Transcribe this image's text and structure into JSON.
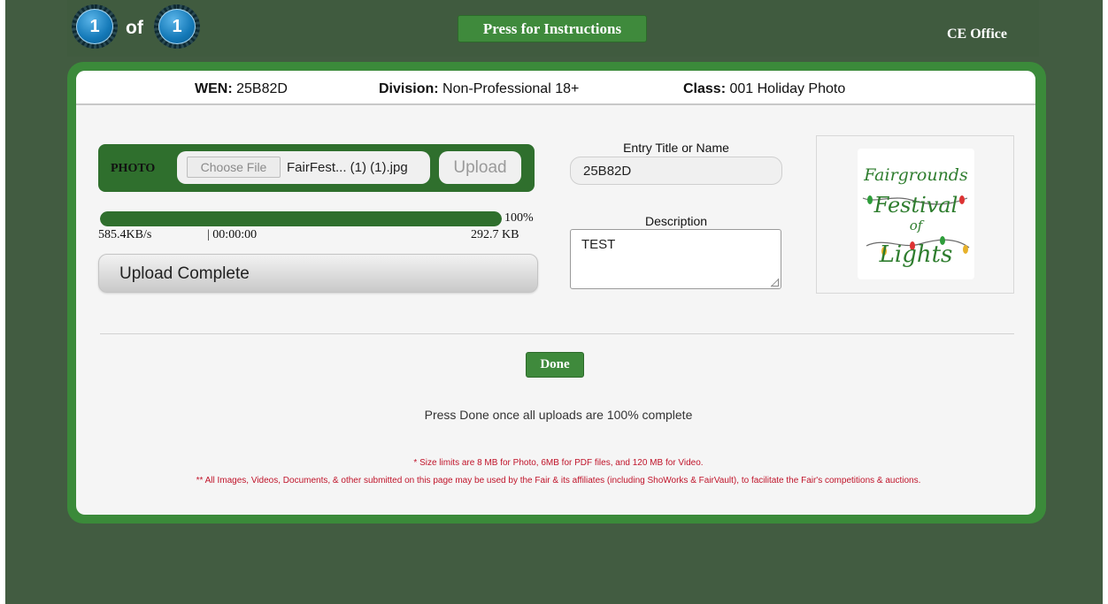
{
  "topbar": {
    "current_page": "1",
    "of_label": "of",
    "total_pages": "1",
    "instructions_button": "Press for Instructions",
    "office_label": "CE Office"
  },
  "entry": {
    "wen_label": "WEN:",
    "wen_value": "25B82D",
    "division_label": "Division:",
    "division_value": "Non-Professional 18+",
    "class_label": "Class:",
    "class_value": "001 Holiday Photo"
  },
  "upload": {
    "photo_label": "PHOTO",
    "choose_file_label": "Choose File",
    "file_name": "FairFest... (1) (1).jpg",
    "upload_button": "Upload",
    "progress_fraction": 1.0,
    "progress_percent": "100%",
    "speed": "585.4KB/s",
    "elapsed": "| 00:00:00",
    "size": "292.7 KB",
    "status": "Upload Complete"
  },
  "form": {
    "title_label": "Entry Title or Name",
    "title_value": "25B82D",
    "description_label": "Description",
    "description_value": "TEST"
  },
  "logo": {
    "lines": [
      "Fairgrounds",
      "Festival",
      "of",
      "Lights"
    ],
    "text_color": "#2e7d2e"
  },
  "footer": {
    "done_button": "Done",
    "done_note": "Press Done once all uploads are 100% complete",
    "size_limits": "* Size limits are 8 MB for Photo, 6MB for PDF files, and 120 MB for Video.",
    "usage_note": "** All Images, Videos, Documents, & other submitted on this page may be used by the Fair & its affiliates (including ShoWorks & FairVault), to facilitate the Fair's competitions & auctions."
  },
  "colors": {
    "page_background": "#425c41",
    "frame_green": "#3b8a3a",
    "button_green": "#3f8a3c",
    "progress_green": "#2f6f2d",
    "fine_print_red": "#c0142a"
  }
}
